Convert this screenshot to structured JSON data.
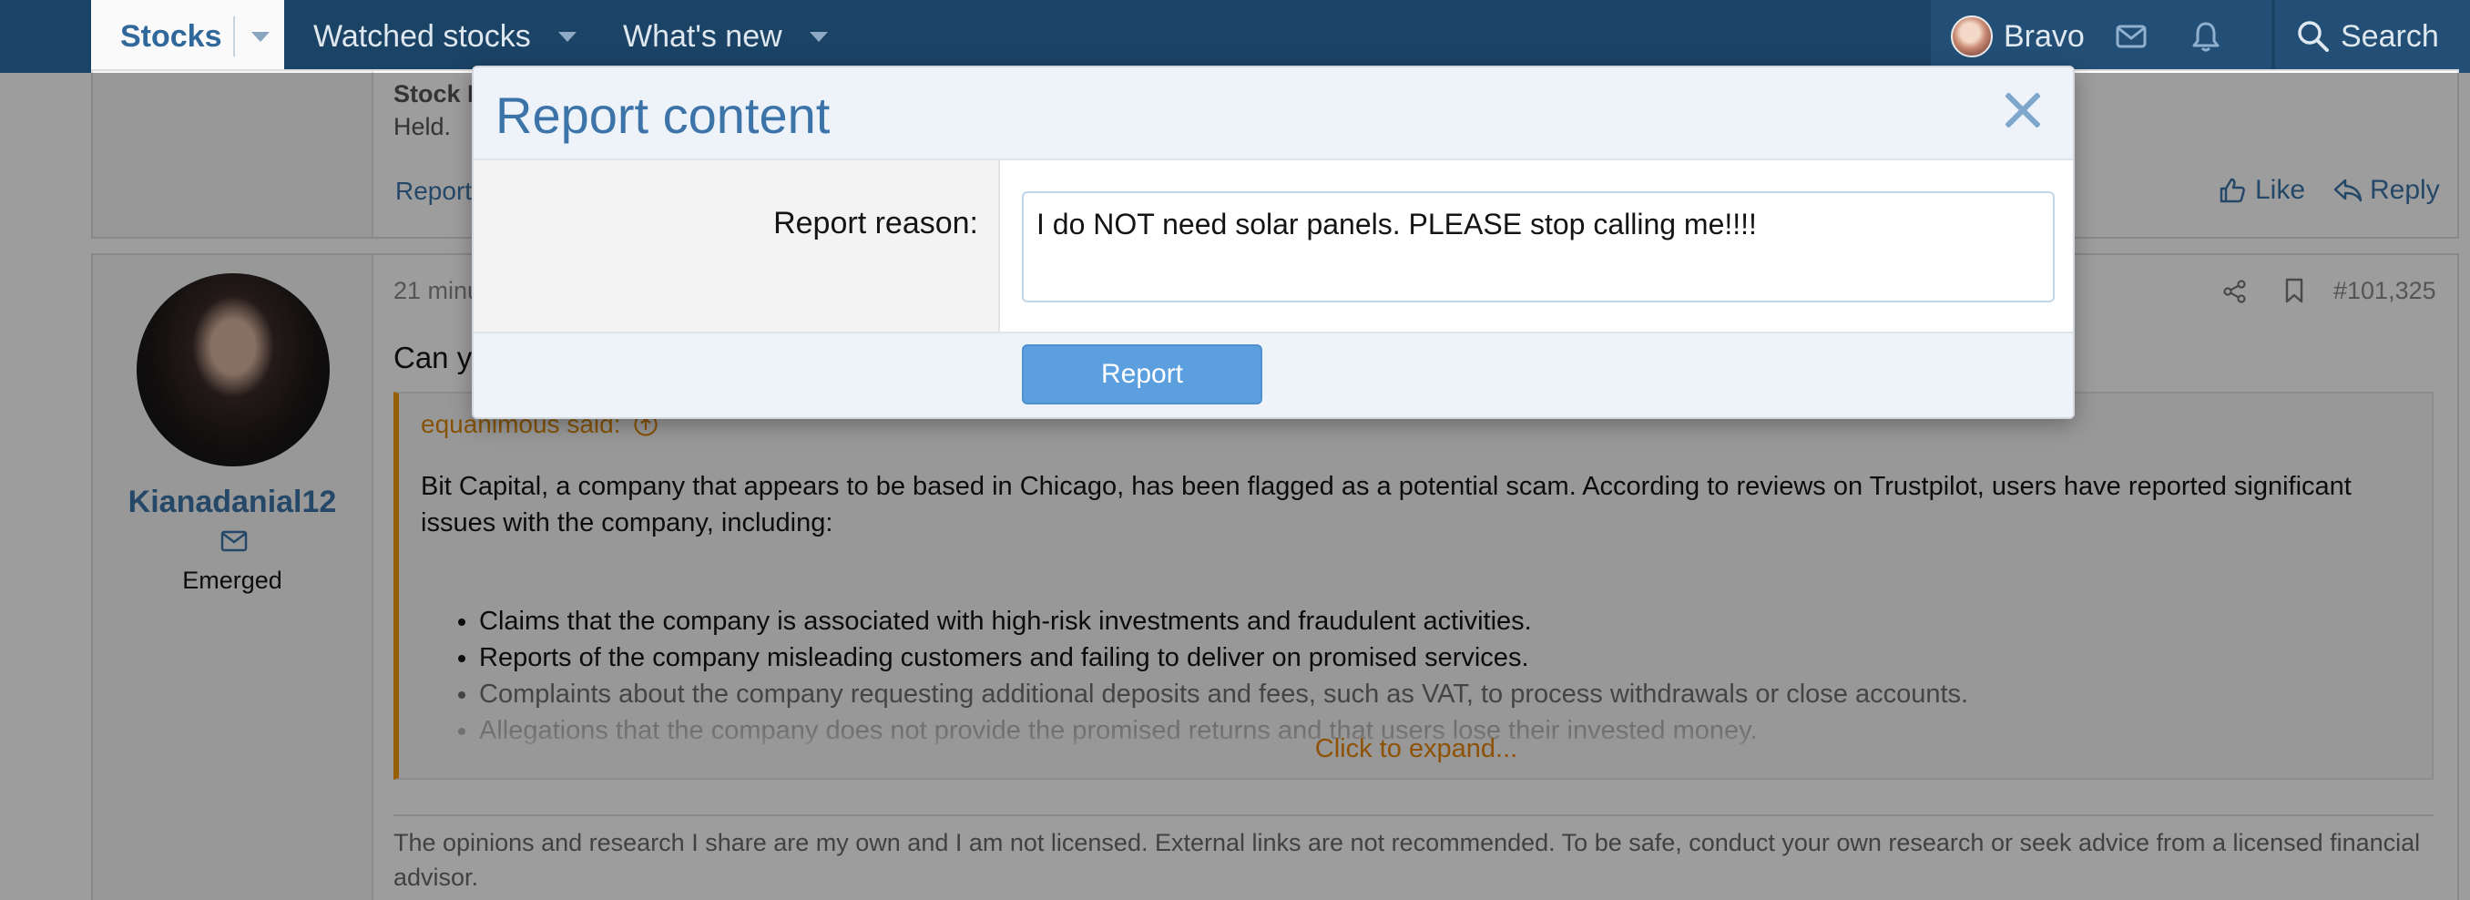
{
  "nav": {
    "active_tab": "Stocks",
    "tabs": [
      "Watched stocks",
      "What's new"
    ],
    "username": "Bravo",
    "search_label": "Search"
  },
  "prev_post": {
    "heading": "Stock I",
    "text": "Held.",
    "report_link": "Report",
    "like_label": "Like",
    "reply_label": "Reply"
  },
  "post": {
    "username": "Kianadanial12",
    "user_title": "Emerged",
    "time": "21 minu",
    "post_number": "#101,325",
    "opening_text": "Can y",
    "quote_author": "equanimous said:",
    "quote_para": "Bit Capital, a company that appears to be based in Chicago, has been flagged as a potential scam. According to reviews on Trustpilot, users have reported significant issues with the company, including:",
    "quote_items": [
      "Claims that the company is associated with high-risk investments and fraudulent activities.",
      "Reports of the company misleading customers and failing to deliver on promised services.",
      "Complaints about the company requesting additional deposits and fees, such as VAT, to process withdrawals or close accounts.",
      "Allegations that the company does not provide the promised returns and that users lose their invested money."
    ],
    "expand_label": "Click to expand...",
    "signature": "The opinions and research I share are my own and I am not licensed. External links are not recommended. To be safe, conduct your own research or seek advice from a licensed financial advisor."
  },
  "modal": {
    "title": "Report content",
    "reason_label": "Report reason:",
    "reason_value": "I do NOT need solar panels. PLEASE stop calling me!!!!",
    "submit_label": "Report"
  },
  "colors": {
    "navbar": "#1b4366",
    "accent": "#3c73a8",
    "quote_border": "#f59a00",
    "report_button": "#5b9fde"
  }
}
